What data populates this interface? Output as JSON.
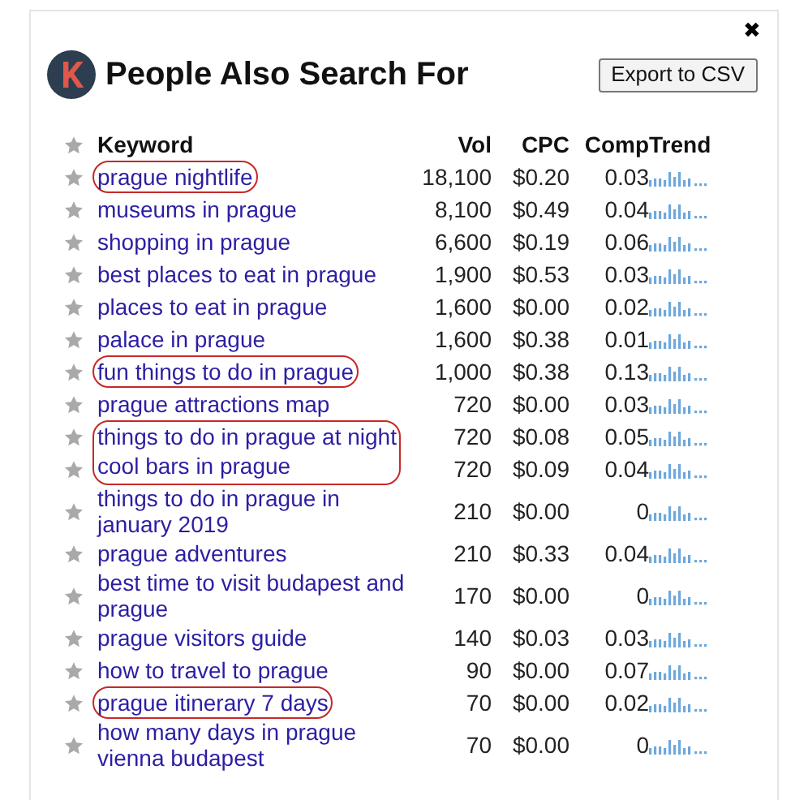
{
  "title": "People Also Search For",
  "close": "✖",
  "export_button": "Export to CSV",
  "columns": [
    "Keyword",
    "Vol",
    "CPC",
    "Comp",
    "Trend"
  ],
  "rows": [
    {
      "keyword": "prague nightlife",
      "vol": "18,100",
      "cpc": "$0.20",
      "comp": "0.03",
      "circled": true
    },
    {
      "keyword": "museums in prague",
      "vol": "8,100",
      "cpc": "$0.49",
      "comp": "0.04",
      "circled": false
    },
    {
      "keyword": "shopping in prague",
      "vol": "6,600",
      "cpc": "$0.19",
      "comp": "0.06",
      "circled": false
    },
    {
      "keyword": "best places to eat in prague",
      "vol": "1,900",
      "cpc": "$0.53",
      "comp": "0.03",
      "circled": false
    },
    {
      "keyword": "places to eat in prague",
      "vol": "1,600",
      "cpc": "$0.00",
      "comp": "0.02",
      "circled": false
    },
    {
      "keyword": "palace in prague",
      "vol": "1,600",
      "cpc": "$0.38",
      "comp": "0.01",
      "circled": false
    },
    {
      "keyword": "fun things to do in prague",
      "vol": "1,000",
      "cpc": "$0.38",
      "comp": "0.13",
      "circled": true
    },
    {
      "keyword": "prague attractions map",
      "vol": "720",
      "cpc": "$0.00",
      "comp": "0.03",
      "circled": false
    },
    {
      "keyword": "things to do in prague at night",
      "vol": "720",
      "cpc": "$0.08",
      "comp": "0.05",
      "circled": true
    },
    {
      "keyword": "cool bars in prague",
      "vol": "720",
      "cpc": "$0.09",
      "comp": "0.04",
      "circled": true
    },
    {
      "keyword": "things to do in prague in january 2019",
      "vol": "210",
      "cpc": "$0.00",
      "comp": "0",
      "circled": false
    },
    {
      "keyword": "prague adventures",
      "vol": "210",
      "cpc": "$0.33",
      "comp": "0.04",
      "circled": false
    },
    {
      "keyword": "best time to visit budapest and prague",
      "vol": "170",
      "cpc": "$0.00",
      "comp": "0",
      "circled": false
    },
    {
      "keyword": "prague visitors guide",
      "vol": "140",
      "cpc": "$0.03",
      "comp": "0.03",
      "circled": false
    },
    {
      "keyword": "how to travel to prague",
      "vol": "90",
      "cpc": "$0.00",
      "comp": "0.07",
      "circled": false
    },
    {
      "keyword": "prague itinerary 7 days",
      "vol": "70",
      "cpc": "$0.00",
      "comp": "0.02",
      "circled": true
    },
    {
      "keyword": "how many days in prague vienna budapest",
      "vol": "70",
      "cpc": "$0.00",
      "comp": "0",
      "circled": false
    }
  ]
}
